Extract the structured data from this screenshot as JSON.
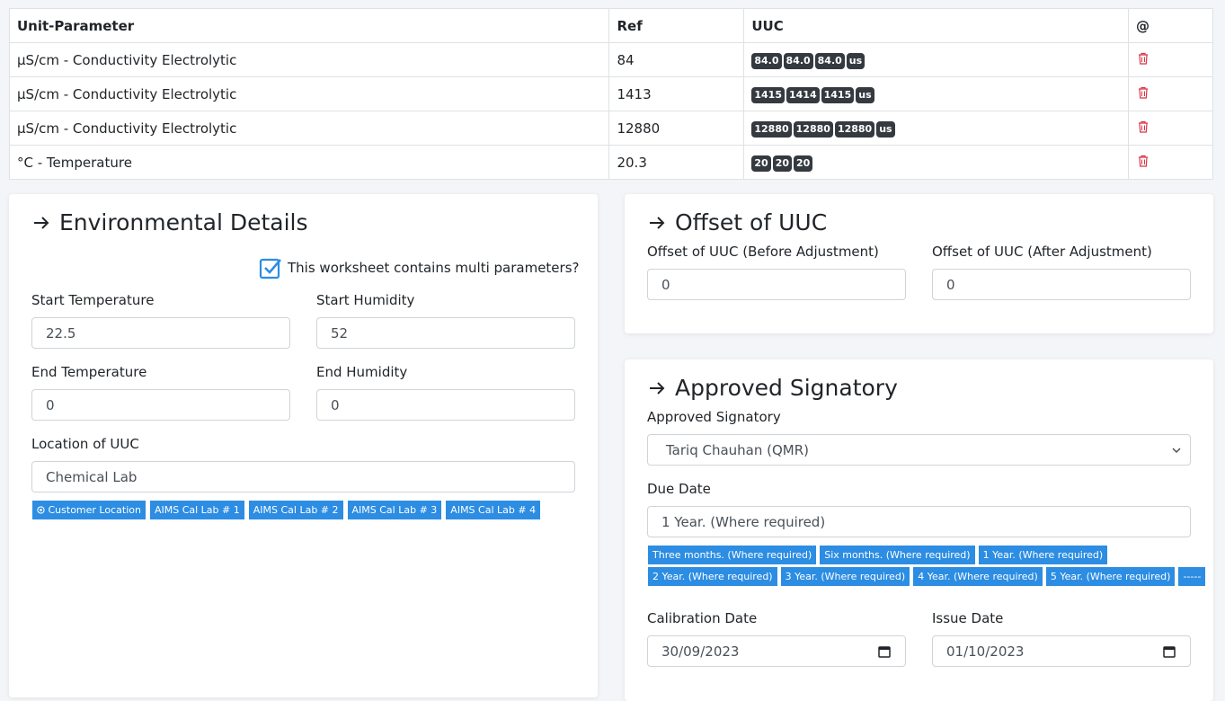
{
  "table": {
    "headers": [
      "Unit-Parameter",
      "Ref",
      "UUC",
      "@"
    ],
    "rows": [
      {
        "parameter": "µS/cm - Conductivity Electrolytic",
        "ref": "84",
        "readings": [
          "84.0",
          "84.0",
          "84.0",
          "us"
        ]
      },
      {
        "parameter": "µS/cm - Conductivity Electrolytic",
        "ref": "1413",
        "readings": [
          "1415",
          "1414",
          "1415",
          "us"
        ]
      },
      {
        "parameter": "µS/cm - Conductivity Electrolytic",
        "ref": "12880",
        "readings": [
          "12880",
          "12880",
          "12880",
          "us"
        ]
      },
      {
        "parameter": "°C - Temperature",
        "ref": "20.3",
        "readings": [
          "20",
          "20",
          "20"
        ]
      }
    ],
    "delete_icon": "trash-icon",
    "delete_color": "#dc3545"
  },
  "environmental": {
    "title": "Environmental Details",
    "multi_param_label": "This worksheet contains multi parameters?",
    "multi_param_checked": true,
    "start_temp_label": "Start Temperature",
    "start_temp_value": "22.5",
    "start_humidity_label": "Start Humidity",
    "start_humidity_value": "52",
    "end_temp_label": "End Temperature",
    "end_temp_value": "0",
    "end_humidity_label": "End Humidity",
    "end_humidity_value": "0",
    "location_label": "Location of UUC",
    "location_value": "Chemical Lab",
    "location_chips": [
      "Customer Location",
      "AIMS Cal Lab # 1",
      "AIMS Cal Lab # 2",
      "AIMS Cal Lab # 3",
      "AIMS Cal Lab # 4"
    ]
  },
  "offset": {
    "title": "Offset of UUC",
    "before_label": "Offset of UUC (Before Adjustment)",
    "before_value": "0",
    "after_label": "Offset of UUC (After Adjustment)",
    "after_value": "0"
  },
  "signatory": {
    "title": "Approved Signatory",
    "signatory_label": "Approved Signatory",
    "signatory_value": "Tariq Chauhan (QMR)",
    "due_label": "Due Date",
    "due_value": "1 Year. (Where required)",
    "due_chips_row1": [
      "Three months. (Where required)",
      "Six months. (Where required)",
      "1 Year. (Where required)"
    ],
    "due_chips_row2": [
      "2 Year. (Where required)",
      "3 Year. (Where required)",
      "4 Year. (Where required)",
      "5 Year. (Where required)",
      "-----"
    ],
    "calibration_label": "Calibration Date",
    "calibration_value": "30/09/2023",
    "issue_label": "Issue Date",
    "issue_value": "01/10/2023"
  },
  "colors": {
    "accent": "#2c8de3",
    "badge": "#343a40",
    "danger": "#dc3545"
  }
}
